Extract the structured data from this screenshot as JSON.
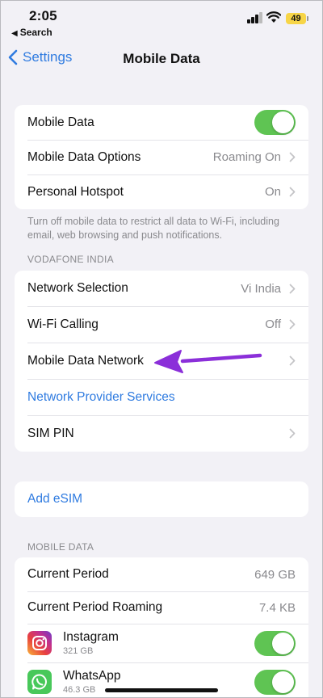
{
  "status": {
    "time": "2:05",
    "back_app": "Search",
    "battery": "49"
  },
  "nav": {
    "back_label": "Settings",
    "title": "Mobile Data"
  },
  "group1": {
    "rows": [
      {
        "label": "Mobile Data",
        "toggle_on": true
      },
      {
        "label": "Mobile Data Options",
        "value": "Roaming On"
      },
      {
        "label": "Personal Hotspot",
        "value": "On"
      }
    ],
    "footnote": "Turn off mobile data to restrict all data to Wi-Fi, including email, web browsing and push notifications."
  },
  "carrier_header": "VODAFONE INDIA",
  "group2": {
    "rows": [
      {
        "label": "Network Selection",
        "value": "Vi India"
      },
      {
        "label": "Wi-Fi Calling",
        "value": "Off"
      },
      {
        "label": "Mobile Data Network",
        "value": ""
      },
      {
        "label": "Network Provider Services"
      },
      {
        "label": "SIM PIN",
        "value": ""
      }
    ]
  },
  "esim": {
    "label": "Add eSIM"
  },
  "mobile_data_header": "MOBILE DATA",
  "usage": {
    "rows": [
      {
        "label": "Current Period",
        "value": "649 GB"
      },
      {
        "label": "Current Period Roaming",
        "value": "7.4 KB"
      }
    ],
    "apps": [
      {
        "name": "Instagram",
        "size": "321 GB",
        "icon": "instagram-icon",
        "toggle_on": true
      },
      {
        "name": "WhatsApp",
        "size": "46.3 GB",
        "icon": "whatsapp-icon",
        "toggle_on": true
      }
    ]
  },
  "colors": {
    "accent": "#2f7be0",
    "toggle_on": "#5fc453",
    "annotation_arrow": "#8b2fd9",
    "background": "#f2f1f6"
  }
}
